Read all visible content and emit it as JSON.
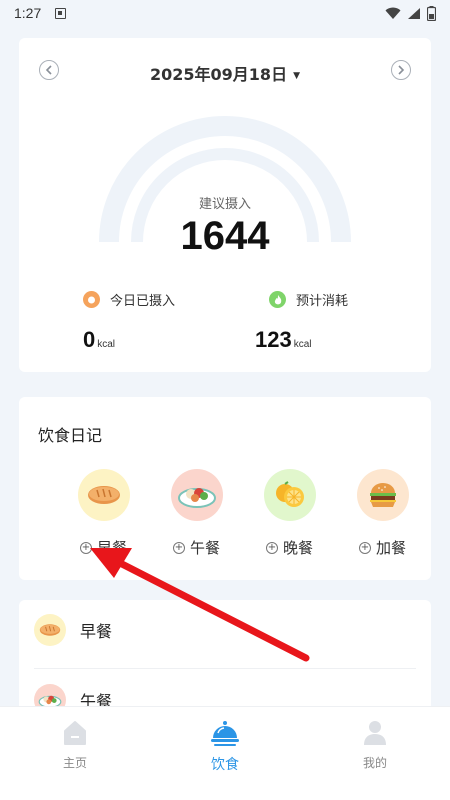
{
  "status_bar": {
    "time": "1:27"
  },
  "date_nav": {
    "date": "2025年09月18日"
  },
  "gauge": {
    "caption": "建议摄入",
    "value": "1644"
  },
  "stats": {
    "intake": {
      "label": "今日已摄入",
      "value": "0",
      "unit": "kcal",
      "color": "#f5a35c"
    },
    "burn": {
      "label": "预计消耗",
      "value": "123",
      "unit": "kcal",
      "color": "#7fd46a"
    }
  },
  "diary": {
    "title": "饮食日记",
    "meals": [
      {
        "label": "早餐",
        "bg": "#fdf3c4"
      },
      {
        "label": "午餐",
        "bg": "#fbd5cc"
      },
      {
        "label": "晚餐",
        "bg": "#e1f7cc"
      },
      {
        "label": "加餐",
        "bg": "#fde6cf"
      }
    ]
  },
  "meal_list": [
    {
      "label": "早餐"
    },
    {
      "label": "午餐"
    }
  ],
  "tabbar": {
    "tabs": [
      {
        "label": "主页",
        "icon": "home-icon"
      },
      {
        "label": "饮食",
        "icon": "food-cloche-icon"
      },
      {
        "label": "我的",
        "icon": "user-icon"
      }
    ],
    "active": 1,
    "active_color": "#2b95e6"
  },
  "arrow_color": "#e8161b"
}
